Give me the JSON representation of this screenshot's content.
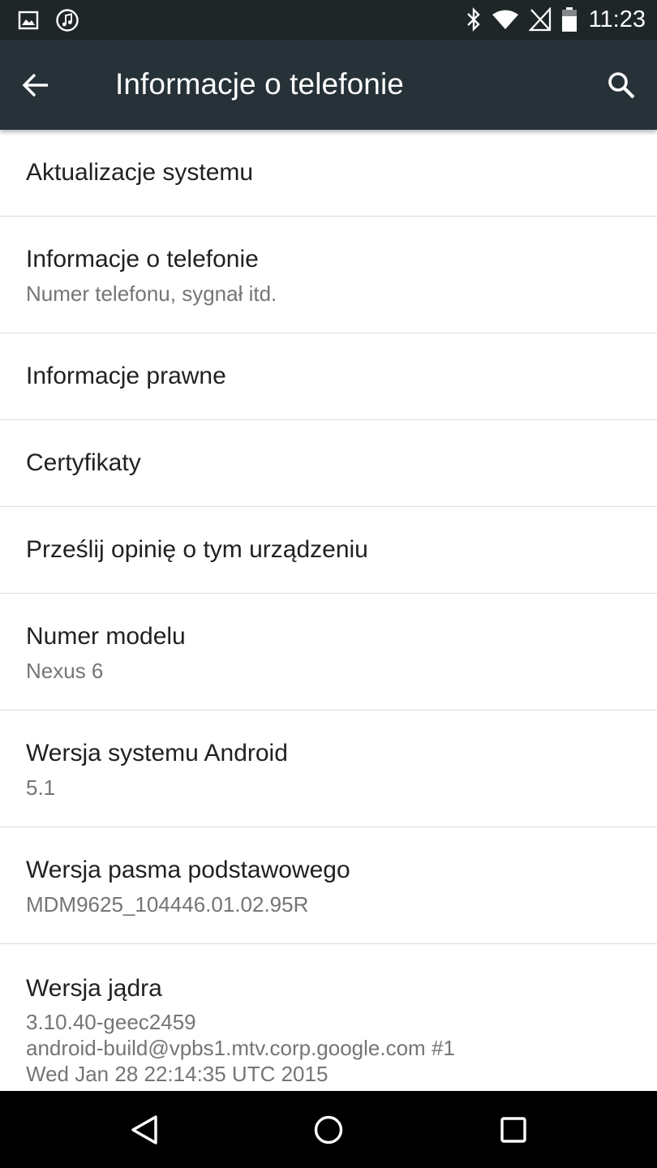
{
  "status_bar": {
    "time": "11:23",
    "left_icons": [
      "image-icon",
      "music-icon"
    ],
    "right_icons": [
      "bluetooth-icon",
      "wifi-icon",
      "no-signal-icon",
      "battery-icon"
    ]
  },
  "app_bar": {
    "title": "Informacje o telefonie",
    "back_icon": "arrow-back-icon",
    "search_icon": "search-icon"
  },
  "items": [
    {
      "title": "Aktualizacje systemu"
    },
    {
      "title": "Informacje o telefonie",
      "summary": "Numer telefonu, sygnał itd."
    },
    {
      "title": "Informacje prawne"
    },
    {
      "title": "Certyfikaty"
    },
    {
      "title": "Prześlij opinię o tym urządzeniu"
    },
    {
      "title": "Numer modelu",
      "summary": "Nexus 6"
    },
    {
      "title": "Wersja systemu Android",
      "summary": "5.1"
    },
    {
      "title": "Wersja pasma podstawowego",
      "summary": "MDM9625_104446.01.02.95R"
    },
    {
      "title": "Wersja jądra",
      "summary_lines": [
        "3.10.40-geec2459",
        "android-build@vpbs1.mtv.corp.google.com #1",
        "Wed Jan 28 22:14:35 UTC 2015"
      ]
    }
  ],
  "nav_bar": {
    "icons": [
      "nav-back-icon",
      "nav-home-icon",
      "nav-recents-icon"
    ]
  },
  "colors": {
    "status_bar": "#1f2628",
    "app_bar": "#263238",
    "title_text": "#212121",
    "summary_text": "#757575",
    "divider": "#dcdcdc"
  }
}
